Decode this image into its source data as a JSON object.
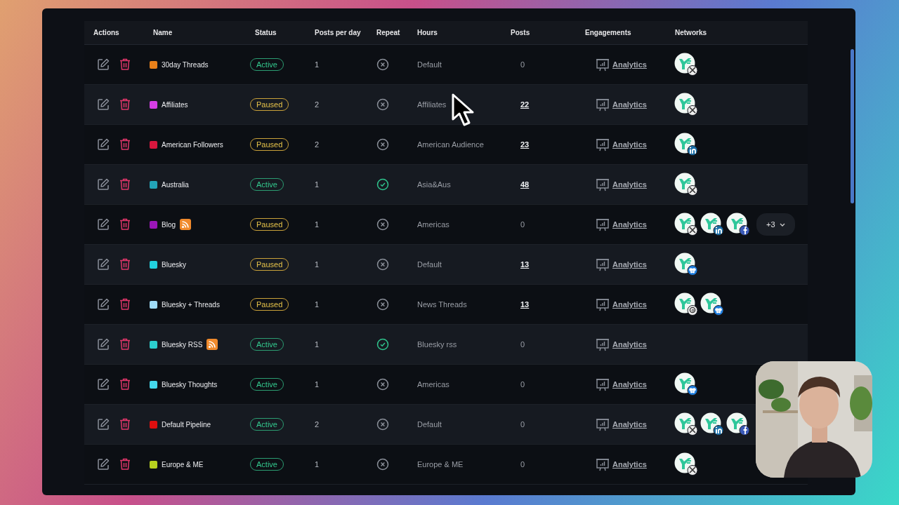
{
  "table": {
    "columns": [
      "Actions",
      "Name",
      "Status",
      "Posts per day",
      "Repeat",
      "Hours",
      "Posts",
      "Engagements",
      "Networks"
    ],
    "rows": [
      {
        "name": "30day Threads",
        "color": "#e8801a",
        "rss": false,
        "status": {
          "kind": "active",
          "label": "Active"
        },
        "per_day": "1",
        "repeat": false,
        "hours": "Default",
        "posts": "0",
        "posts_linked": false,
        "engagement": "Analytics",
        "networks": [
          {
            "kind": "x"
          }
        ]
      },
      {
        "name": "Affiliates",
        "color": "#d63ee6",
        "rss": false,
        "status": {
          "kind": "paused",
          "label": "Paused"
        },
        "per_day": "2",
        "repeat": false,
        "hours": "Affiliates",
        "posts": "22",
        "posts_linked": true,
        "engagement": "Analytics",
        "networks": [
          {
            "kind": "x"
          }
        ]
      },
      {
        "name": "American Followers",
        "color": "#d8173e",
        "rss": false,
        "status": {
          "kind": "paused",
          "label": "Paused"
        },
        "per_day": "2",
        "repeat": false,
        "hours": "American Audience",
        "posts": "23",
        "posts_linked": true,
        "engagement": "Analytics",
        "networks": [
          {
            "kind": "linkedin"
          }
        ]
      },
      {
        "name": "Australia",
        "color": "#23a4b8",
        "rss": false,
        "status": {
          "kind": "active",
          "label": "Active"
        },
        "per_day": "1",
        "repeat": true,
        "hours": "Asia&Aus",
        "posts": "48",
        "posts_linked": true,
        "engagement": "Analytics",
        "networks": [
          {
            "kind": "x"
          }
        ]
      },
      {
        "name": "Blog",
        "color": "#9a16b8",
        "rss": true,
        "status": {
          "kind": "paused",
          "label": "Paused"
        },
        "per_day": "1",
        "repeat": false,
        "hours": "Americas",
        "posts": "0",
        "posts_linked": false,
        "engagement": "Analytics",
        "networks": [
          {
            "kind": "x"
          },
          {
            "kind": "linkedin"
          },
          {
            "kind": "facebook"
          }
        ],
        "more": "+3"
      },
      {
        "name": "Bluesky",
        "color": "#22d0de",
        "rss": false,
        "status": {
          "kind": "paused",
          "label": "Paused"
        },
        "per_day": "1",
        "repeat": false,
        "hours": "Default",
        "posts": "13",
        "posts_linked": true,
        "engagement": "Analytics",
        "networks": [
          {
            "kind": "bluesky"
          }
        ]
      },
      {
        "name": "Bluesky + Threads",
        "color": "#9fdcf8",
        "rss": false,
        "status": {
          "kind": "paused",
          "label": "Paused"
        },
        "per_day": "1",
        "repeat": false,
        "hours": "News Threads",
        "posts": "13",
        "posts_linked": true,
        "engagement": "Analytics",
        "networks": [
          {
            "kind": "threads"
          },
          {
            "kind": "bluesky"
          }
        ]
      },
      {
        "name": "Bluesky RSS",
        "color": "#2ccfce",
        "rss": true,
        "status": {
          "kind": "active",
          "label": "Active"
        },
        "per_day": "1",
        "repeat": true,
        "hours": "Bluesky rss",
        "posts": "0",
        "posts_linked": false,
        "engagement": "Analytics"
      },
      {
        "name": "Bluesky Thoughts",
        "color": "#44d8ec",
        "rss": false,
        "status": {
          "kind": "active",
          "label": "Active"
        },
        "per_day": "1",
        "repeat": false,
        "hours": "Americas",
        "posts": "0",
        "posts_linked": false,
        "engagement": "Analytics",
        "networks": [
          {
            "kind": "bluesky"
          }
        ]
      },
      {
        "name": "Default Pipeline",
        "color": "#de0f0f",
        "rss": false,
        "status": {
          "kind": "active",
          "label": "Active"
        },
        "per_day": "2",
        "repeat": false,
        "hours": "Default",
        "posts": "0",
        "posts_linked": false,
        "engagement": "Analytics",
        "networks": [
          {
            "kind": "x"
          },
          {
            "kind": "linkedin"
          },
          {
            "kind": "facebook"
          }
        ]
      },
      {
        "name": "Europe & ME",
        "color": "#b6d11f",
        "rss": false,
        "status": {
          "kind": "active",
          "label": "Active"
        },
        "per_day": "1",
        "repeat": false,
        "hours": "Europe & ME",
        "posts": "0",
        "posts_linked": false,
        "engagement": "Analytics",
        "networks": [
          {
            "kind": "x"
          }
        ]
      }
    ]
  }
}
